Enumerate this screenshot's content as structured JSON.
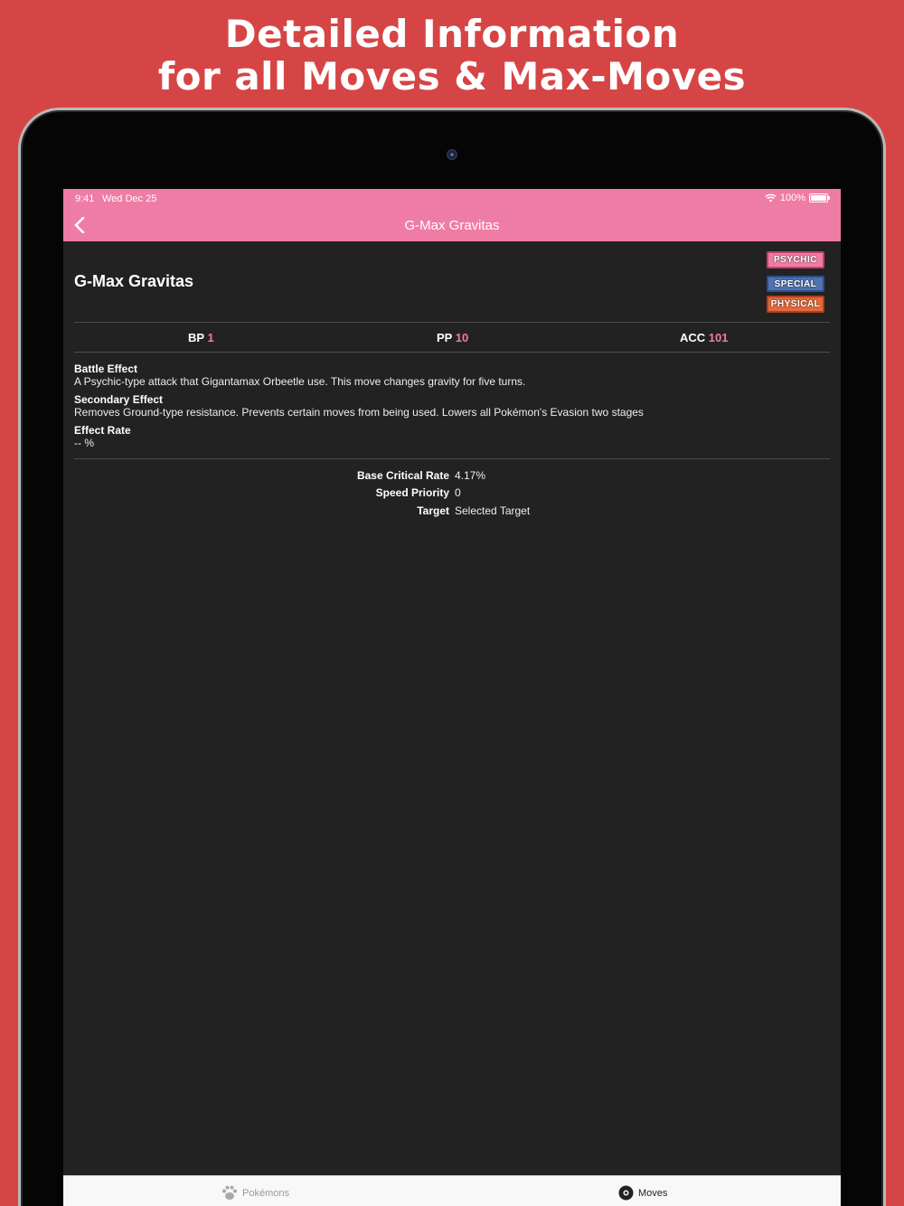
{
  "promo": {
    "line1": "Detailed Information",
    "line2": "for all Moves & Max-Moves"
  },
  "status_bar": {
    "time": "9:41",
    "date": "Wed Dec 25",
    "battery": "100%"
  },
  "nav": {
    "title": "G-Max Gravitas"
  },
  "move": {
    "name": "G-Max Gravitas",
    "badges": {
      "type": "PSYCHIC",
      "special": "SPECIAL",
      "physical": "PHYSICAL"
    },
    "stats": {
      "bp_label": "BP",
      "bp_value": "1",
      "pp_label": "PP",
      "pp_value": "10",
      "acc_label": "ACC",
      "acc_value": "101"
    },
    "battle_effect": {
      "title": "Battle Effect",
      "text": "A Psychic-type attack that Gigantamax Orbeetle use. This move changes gravity for five turns."
    },
    "secondary_effect": {
      "title": "Secondary Effect",
      "text": "Removes Ground-type resistance. Prevents certain moves from being used. Lowers all Pokémon's Evasion two stages"
    },
    "effect_rate": {
      "title": "Effect Rate",
      "text": "-- %"
    },
    "details": [
      {
        "label": "Base Critical Rate",
        "value": "4.17%"
      },
      {
        "label": "Speed Priority",
        "value": "0"
      },
      {
        "label": "Target",
        "value": "Selected Target"
      }
    ]
  },
  "tabs": [
    {
      "label": "Pokémons",
      "icon": "paw-icon",
      "selected": false
    },
    {
      "label": "Moves",
      "icon": "pokeball-icon",
      "selected": true
    }
  ],
  "colors": {
    "background": "#d64545",
    "accent": "#ef7ca5",
    "screen": "#222222",
    "special": "#4f73b0",
    "physical": "#e36a3c"
  }
}
